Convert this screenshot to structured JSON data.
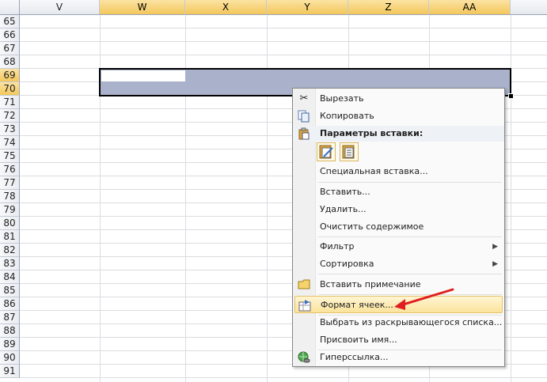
{
  "sheet": {
    "columns": [
      "V",
      "W",
      "X",
      "Y",
      "Z",
      "AA"
    ],
    "rows": [
      "65",
      "66",
      "67",
      "68",
      "69",
      "70",
      "71",
      "72",
      "73",
      "74",
      "75",
      "76",
      "77",
      "78",
      "79",
      "80",
      "81",
      "82",
      "83",
      "84",
      "85",
      "86",
      "87",
      "88",
      "89",
      "90",
      "91"
    ],
    "selected_columns": [
      "W",
      "X",
      "Y",
      "Z",
      "AA"
    ],
    "selected_rows": [
      "69",
      "70"
    ]
  },
  "context_menu": {
    "cut": "Вырезать",
    "copy": "Копировать",
    "paste_options_header": "Параметры вставки:",
    "paste_special": "Специальная вставка...",
    "insert": "Вставить...",
    "delete": "Удалить...",
    "clear_contents": "Очистить содержимое",
    "filter": "Фильтр",
    "sort": "Сортировка",
    "insert_comment": "Вставить примечание",
    "format_cells": "Формат ячеек...",
    "pick_from_list": "Выбрать из раскрывающегося списка...",
    "define_name": "Присвоить имя...",
    "hyperlink": "Гиперссылка..."
  },
  "icons": {
    "cut": "scissors-icon",
    "copy": "copy-icon",
    "paste": "clipboard-icon",
    "comment": "comment-icon",
    "format": "format-cells-icon",
    "hyperlink": "hyperlink-globe-icon",
    "annotation": "red-arrow"
  },
  "colors": {
    "selection_fill": "#a9b1cb",
    "header_selected": "#f3c75b",
    "menu_highlight": "#fbe39b",
    "annotation_arrow": "#e02020"
  }
}
